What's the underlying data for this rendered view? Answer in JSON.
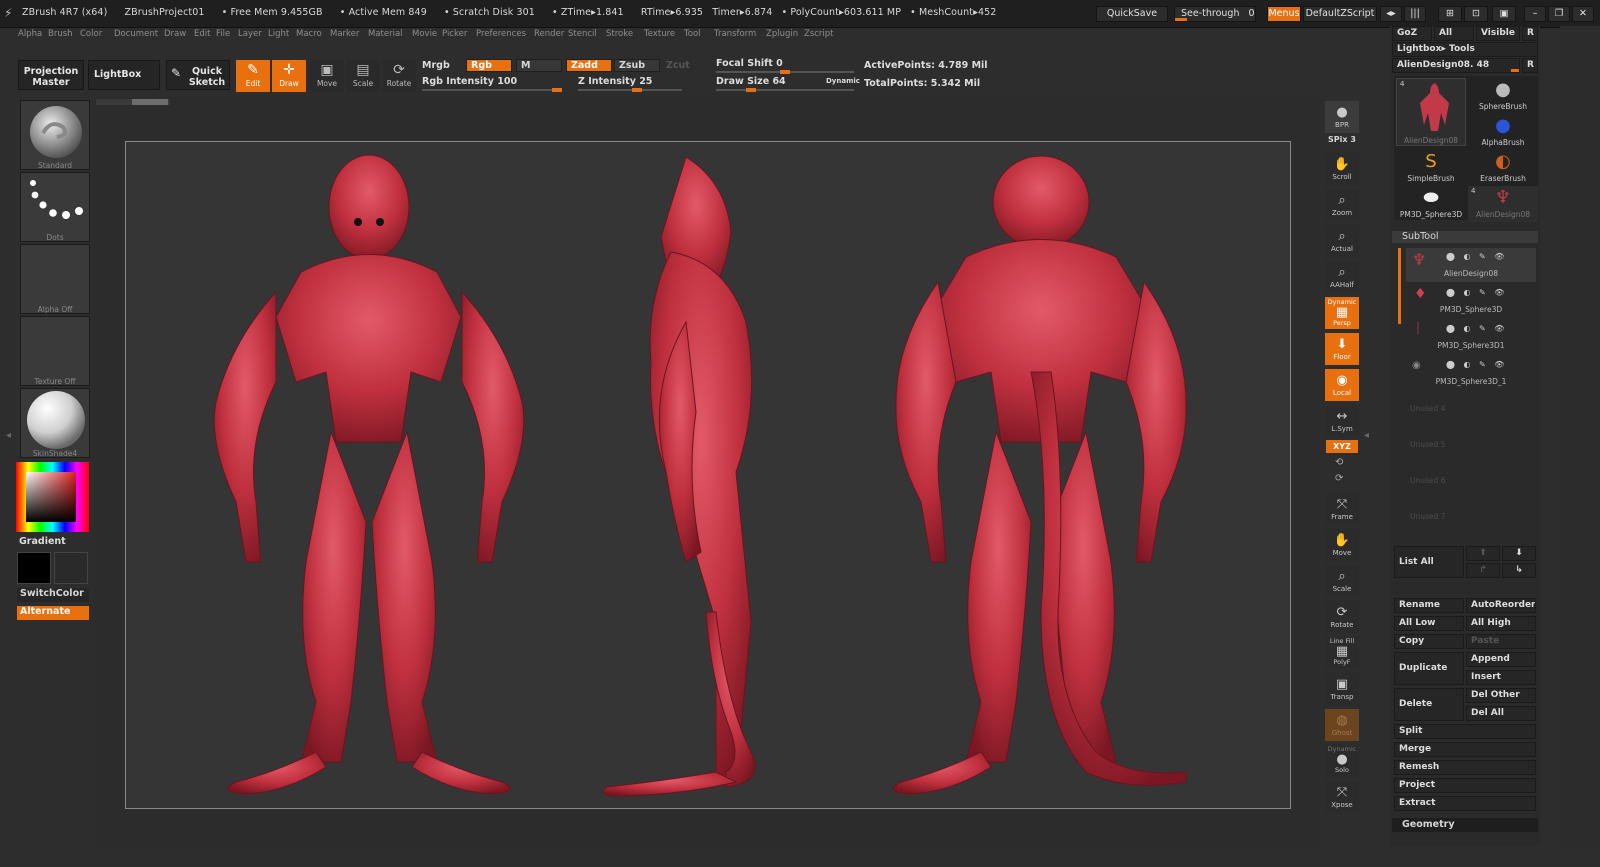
{
  "titlebar": {
    "app": "ZBrush 4R7 (x64)",
    "project": "ZBrushProject01",
    "free_mem": "• Free Mem 9.455GB",
    "active_mem": "• Active Mem 849",
    "scratch_disk": "• Scratch Disk 301",
    "ztime": "• ZTime▸1.841",
    "rtime": "RTime▸6.935",
    "timer": "Timer▸6.874",
    "polycount": "• PolyCount▸603.611 MP",
    "meshcount": "• MeshCount▸452",
    "quicksave": "QuickSave",
    "see_through_label": "See-through",
    "see_through_value": "0",
    "menus": "Menus",
    "default_zscript": "DefaultZScript"
  },
  "menubar": [
    "Alpha",
    "Brush",
    "Color",
    "Document",
    "Draw",
    "Edit",
    "File",
    "Layer",
    "Light",
    "Macro",
    "Marker",
    "Material",
    "Movie",
    "Picker",
    "Preferences",
    "Render",
    "Stencil",
    "Stroke",
    "Texture",
    "Tool",
    "Transform",
    "Zplugin",
    "Zscript"
  ],
  "toolbar": {
    "projection_master_1": "Projection",
    "projection_master_2": "Master",
    "lightbox": "LightBox",
    "quick_sketch_1": "Quick",
    "quick_sketch_2": "Sketch",
    "edit": "Edit",
    "draw": "Draw",
    "move": "Move",
    "scale": "Scale",
    "rotate": "Rotate",
    "mrgb": "Mrgb",
    "rgb": "Rgb",
    "m": "M",
    "zadd": "Zadd",
    "zsub": "Zsub",
    "zcut": "Zcut",
    "rgb_intensity": "Rgb Intensity 100",
    "z_intensity": "Z Intensity 25",
    "focal_shift": "Focal Shift 0",
    "draw_size": "Draw Size 64",
    "dynamic": "Dynamic",
    "active_points": "ActivePoints: 4.789 Mil",
    "total_points": "TotalPoints: 5.342 Mil"
  },
  "leftpanel": {
    "brush": "Standard",
    "stroke": "Dots",
    "alpha": "Alpha Off",
    "texture": "Texture Off",
    "material": "SkinShade4",
    "gradient": "Gradient",
    "switchcolor": "SwitchColor",
    "alternate": "Alternate"
  },
  "midtools": {
    "bpr": "BPR",
    "spix": "SPix 3",
    "scroll": "Scroll",
    "zoom": "Zoom",
    "actual": "Actual",
    "aahalf": "AAHalf",
    "dynamic": "Dynamic",
    "persp": "Persp",
    "floor": "Floor",
    "local": "Local",
    "lsym": "L.Sym",
    "xyz": "XYZ",
    "frame": "Frame",
    "move": "Move",
    "scale": "Scale",
    "rotate": "Rotate",
    "linefill": "Line Fill",
    "polyf": "PolyF",
    "transp": "Transp",
    "ghost": "Ghost",
    "dynamic2": "Dynamic",
    "solo": "Solo",
    "xpose": "Xpose"
  },
  "rightpanel": {
    "goz": "GoZ",
    "all": "All",
    "visible": "Visible",
    "r": "R",
    "lightbox_tools": "Lightbox▸ Tools",
    "current_tool": "AlienDesign08. 48",
    "lightbox_items": [
      {
        "name": "AlienDesign08",
        "count": "4"
      },
      {
        "name": "SphereBrush",
        "count": ""
      },
      {
        "name": "",
        "count": ""
      },
      {
        "name": "AlphaBrush",
        "count": ""
      },
      {
        "name": "SimpleBrush",
        "count": ""
      },
      {
        "name": "EraserBrush",
        "count": ""
      },
      {
        "name": "PM3D_Sphere3D",
        "count": ""
      },
      {
        "name": "AlienDesign08",
        "count": "4"
      }
    ],
    "subtool_header": "SubTool",
    "subtools": [
      "AlienDesign08",
      "PM3D_Sphere3D",
      "PM3D_Sphere3D1",
      "PM3D_Sphere3D_1"
    ],
    "unused": [
      "Unused 4",
      "Unused 5",
      "Unused 6",
      "Unused 7"
    ],
    "list_all": "List All",
    "rename": "Rename",
    "autoreorder": "AutoReorder",
    "all_low": "All Low",
    "all_high": "All High",
    "copy": "Copy",
    "paste": "Paste",
    "duplicate": "Duplicate",
    "append": "Append",
    "insert": "Insert",
    "delete": "Delete",
    "del_other": "Del Other",
    "del_all": "Del All",
    "split": "Split",
    "merge": "Merge",
    "remesh": "Remesh",
    "project": "Project",
    "extract": "Extract",
    "geometry": "Geometry"
  },
  "colors": {
    "accent": "#e8700f",
    "panel": "#2a2a2a",
    "canvas": "#353535",
    "creature": "#c23a4a"
  }
}
